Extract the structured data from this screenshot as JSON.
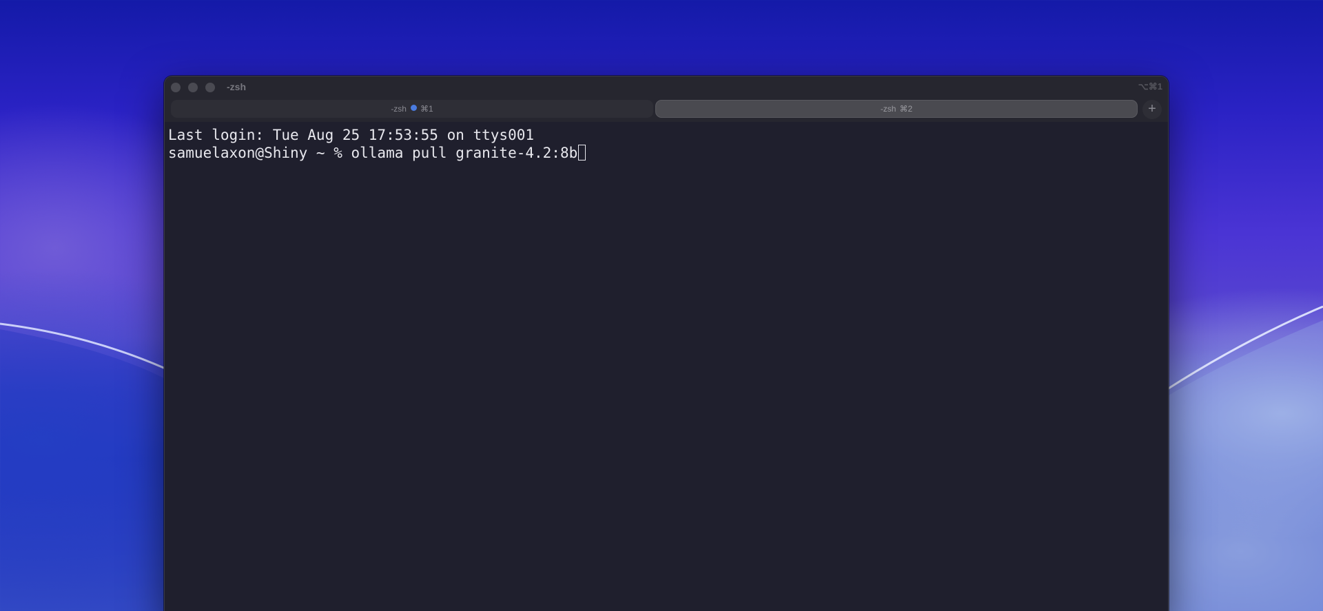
{
  "window": {
    "title": "-zsh",
    "shortcut": "⌥⌘1"
  },
  "tabs": [
    {
      "label": "-zsh",
      "shortcut": "⌘1",
      "active": false,
      "indicator_color": "#4a7be0"
    },
    {
      "label": "-zsh",
      "shortcut": "⌘2",
      "active": true
    }
  ],
  "new_tab": {
    "icon": "plus-icon",
    "label": "+"
  },
  "terminal": {
    "lines": [
      "Last login: Tue Aug 25 17:53:55 on ttys001",
      "samuelaxon@Shiny ~ % ollama pull granite-4.2:8b"
    ]
  }
}
